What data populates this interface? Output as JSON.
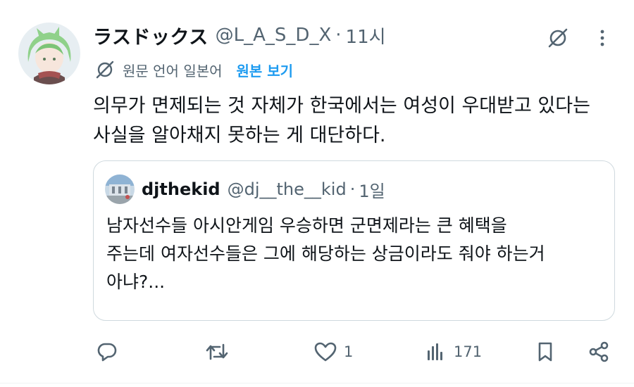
{
  "tweet": {
    "display_name": "ラスドックス",
    "handle": "@L_A_S_D_X",
    "separator": "·",
    "time": "11시",
    "translation": {
      "label": "원문 언어 일본어",
      "show_original": "원본 보기"
    },
    "text_lines": [
      "의무가 면제되는 것 자체가 한국에서는 여성이 우대받고 있다는",
      "사실을 알아채지 못하는 게 대단하다."
    ]
  },
  "quote": {
    "display_name": "djthekid",
    "handle": "@dj__the__kid",
    "separator": "·",
    "time": "1일",
    "text_lines": [
      "남자선수들 아시안게임 우승하면 군면제라는 큰 혜택을",
      "주는데 여자선수들은 그에 해당하는 상금이라도 줘야 하는거",
      "아냐?..."
    ]
  },
  "actions": {
    "reply": {
      "icon": "reply-icon",
      "count": ""
    },
    "retweet": {
      "icon": "retweet-icon",
      "count": ""
    },
    "like": {
      "icon": "heart-icon",
      "count": "1"
    },
    "views": {
      "icon": "views-icon",
      "count": "171"
    },
    "bookmark": {
      "icon": "bookmark-icon"
    },
    "share": {
      "icon": "share-icon"
    }
  },
  "colors": {
    "text": "#0f1419",
    "secondary": "#536471",
    "accent": "#1d9bf0",
    "border": "#cfd9de"
  }
}
